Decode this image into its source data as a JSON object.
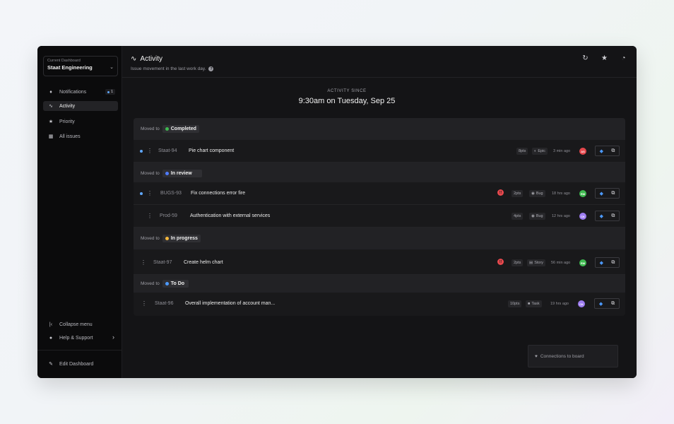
{
  "sidebar": {
    "dashboard_label": "Current Dashboard",
    "dashboard_value": "Staat Engineering",
    "nav": [
      {
        "label": "Notifications",
        "icon": "bell-icon",
        "badge": "1"
      },
      {
        "label": "Activity",
        "icon": "activity-icon"
      },
      {
        "label": "Priority",
        "icon": "star-icon"
      },
      {
        "label": "All issues",
        "icon": "grid-icon"
      }
    ],
    "collapse_label": "Collapse menu",
    "help_label": "Help & Support",
    "edit_label": "Edit Dashboard"
  },
  "header": {
    "title": "Activity",
    "subtitle": "Issue movement in the last work day."
  },
  "since": {
    "label": "ACTIVITY SINCE",
    "value": "9:30am on Tuesday, Sep 25"
  },
  "groups": [
    {
      "prefix": "Moved to",
      "status": "Completed",
      "color": "#3fb950"
    },
    {
      "prefix": "Moved to",
      "status": "In review",
      "color": "#4f7cff"
    },
    {
      "prefix": "Moved to",
      "status": "In progress",
      "color": "#f5b73b"
    },
    {
      "prefix": "Moved to",
      "status": "To Do",
      "color": "#4c9aff"
    }
  ],
  "rows": [
    {
      "key": "Staat-94",
      "title": "Pie chart component",
      "points": "8pts",
      "type": "Epic",
      "ago": "3 min ago",
      "avatar": "AS",
      "avatar_color": "#e5484d"
    },
    {
      "key": "BUGS-93",
      "title": "Fix connections error fire",
      "priority": "!!",
      "points": "2pts",
      "type": "Bug",
      "ago": "18 hrs ago",
      "avatar": "RM",
      "avatar_color": "#3fb950"
    },
    {
      "key": "Prod-59",
      "title": "Authentication with external services",
      "points": "4pts",
      "type": "Bug",
      "ago": "12 hrs ago",
      "avatar": "CK",
      "avatar_color": "#9d7cf0"
    },
    {
      "key": "Staat-97",
      "title": "Create helm chart",
      "priority": "!!",
      "points": "2pts",
      "type": "Story",
      "ago": "56 min ago",
      "avatar": "RM",
      "avatar_color": "#3fb950"
    },
    {
      "key": "Staat-96",
      "title": "Overall implementation of account man...",
      "points": "10pts",
      "type": "Task",
      "ago": "19 hrs ago",
      "avatar": "CK",
      "avatar_color": "#9d7cf0"
    }
  ],
  "toast": {
    "label": "Connections to board"
  },
  "colors": {
    "accent": "#5fa8ff",
    "jira": "#4c9aff",
    "priority": "#e5484d"
  }
}
